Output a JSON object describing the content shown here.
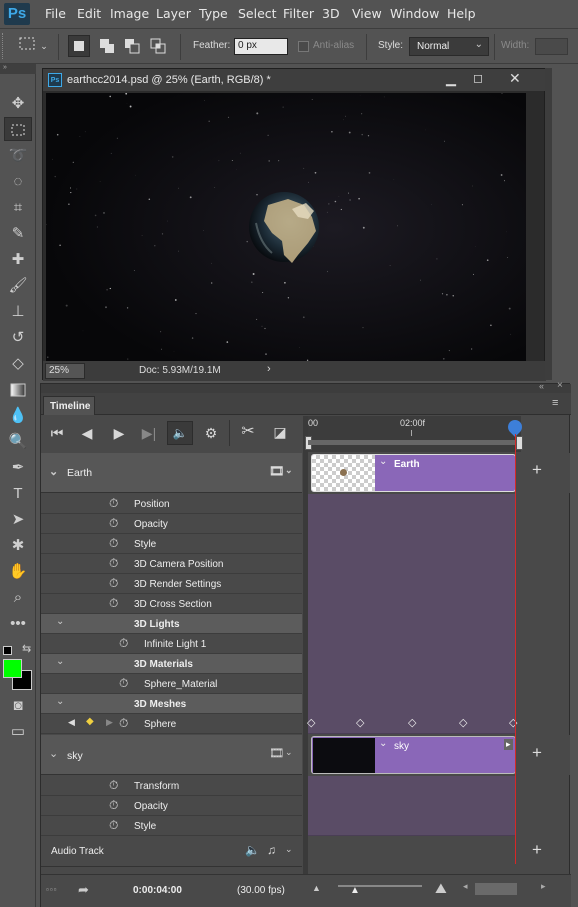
{
  "app": {
    "logo": "Ps"
  },
  "menu": [
    "File",
    "Edit",
    "Image",
    "Layer",
    "Type",
    "Select",
    "Filter",
    "3D",
    "View",
    "Window",
    "Help"
  ],
  "options": {
    "feather_label": "Feather:",
    "feather_value": "0 px",
    "antialias_label": "Anti-alias",
    "style_label": "Style:",
    "style_value": "Normal",
    "width_label": "Width:"
  },
  "document": {
    "title": "earthcc2014.psd @ 25% (Earth, RGB/8) *",
    "zoom": "25%",
    "doc_info": "Doc: 5.93M/19.1M"
  },
  "timeline": {
    "panel_title": "Timeline",
    "ruler_start": "00",
    "ruler_mid": "02:00f",
    "current_time": "0:00:04:00",
    "fps": "(30.00 fps)",
    "audio_track": "Audio Track",
    "layers": {
      "earth": {
        "name": "Earth",
        "clip_label": "Earth",
        "props": [
          "Position",
          "Opacity",
          "Style",
          "3D Camera Position",
          "3D Render Settings",
          "3D Cross Section"
        ],
        "lights_group": "3D Lights",
        "light": "Infinite Light 1",
        "materials_group": "3D Materials",
        "material": "Sphere_Material",
        "meshes_group": "3D Meshes",
        "mesh": "Sphere"
      },
      "sky": {
        "name": "sky",
        "clip_label": "sky",
        "props": [
          "Transform",
          "Opacity",
          "Style"
        ]
      }
    }
  },
  "colors": {
    "foreground": "#00ff00",
    "background": "#000000",
    "clip": "#8a67b8",
    "playhead": "#d62828"
  }
}
